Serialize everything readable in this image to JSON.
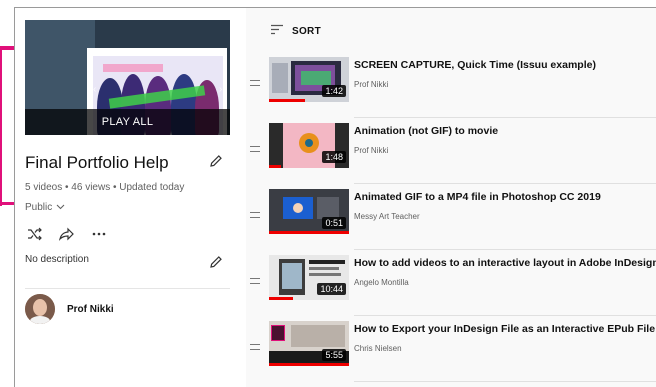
{
  "playlist": {
    "play_all_label": "PLAY ALL",
    "title": "Final Portfolio Help",
    "meta": "5 videos • 46 views • Updated today",
    "privacy": "Public",
    "description": "No description",
    "owner": "Prof Nikki"
  },
  "list": {
    "sort_label": "SORT",
    "videos": [
      {
        "title": "SCREEN CAPTURE, Quick Time (Issuu example)",
        "channel": "Prof Nikki",
        "duration": "1:42",
        "watched_fraction": 0.45
      },
      {
        "title": "Animation (not GIF) to movie",
        "channel": "Prof Nikki",
        "duration": "1:48",
        "watched_fraction": 0.15
      },
      {
        "title": "Animated GIF to a MP4 file in Photoshop CC 2019",
        "channel": "Messy Art Teacher",
        "duration": "0:51",
        "watched_fraction": 1.0
      },
      {
        "title": "How to add videos to an interactive layout in Adobe InDesign",
        "channel": "Angelo Montilla",
        "duration": "10:44",
        "watched_fraction": 0.3
      },
      {
        "title": "How to Export your InDesign File as an Interactive EPub File",
        "channel": "Chris Nielsen",
        "duration": "5:55",
        "watched_fraction": 1.0
      }
    ]
  },
  "colors": {
    "accent_magenta": "#e0107a",
    "progress_red": "#e00000"
  }
}
